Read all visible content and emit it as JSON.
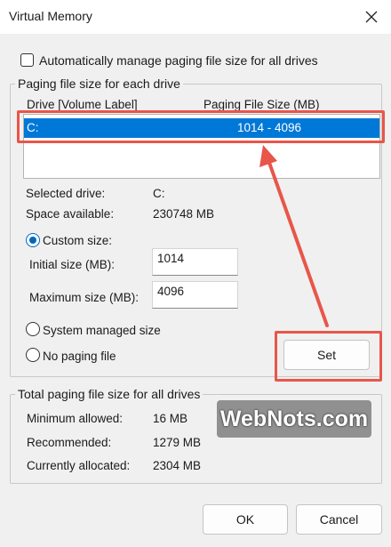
{
  "window": {
    "title": "Virtual Memory",
    "close_icon": "close-icon"
  },
  "auto_manage": {
    "label": "Automatically manage paging file size for all drives",
    "checked": false
  },
  "paging_group": {
    "legend": "Paging file size for each drive",
    "columns": {
      "drive": "Drive  [Volume Label]",
      "size": "Paging File Size (MB)"
    },
    "rows": [
      {
        "drive": "C:",
        "size": "1014 - 4096",
        "selected": true
      }
    ],
    "selected_drive_label": "Selected drive:",
    "selected_drive_value": "C:",
    "space_available_label": "Space available:",
    "space_available_value": "230748 MB",
    "custom_size": {
      "label": "Custom size:",
      "selected": true
    },
    "initial_size": {
      "label": "Initial size (MB):",
      "value": "1014"
    },
    "maximum_size": {
      "label": "Maximum size (MB):",
      "value": "4096"
    },
    "system_managed": {
      "label": "System managed size",
      "selected": false
    },
    "no_paging": {
      "label": "No paging file",
      "selected": false
    },
    "set_label": "Set"
  },
  "total_group": {
    "legend": "Total paging file size for all drives",
    "min_label": "Minimum allowed:",
    "min_value": "16 MB",
    "rec_label": "Recommended:",
    "rec_value": "1279 MB",
    "cur_label": "Currently allocated:",
    "cur_value": "2304 MB"
  },
  "watermark": "WebNots.com",
  "buttons": {
    "ok": "OK",
    "cancel": "Cancel"
  },
  "colors": {
    "selection": "#0078d7",
    "annotation": "#e8564a",
    "radio_accent": "#0067c0"
  }
}
